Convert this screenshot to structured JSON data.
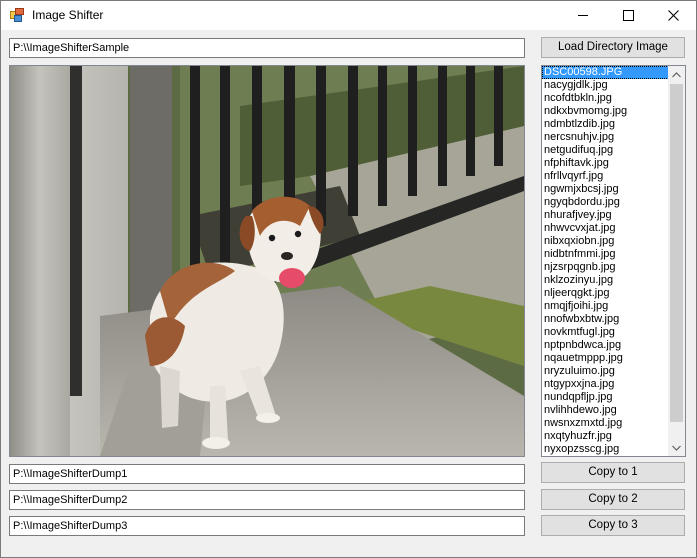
{
  "window": {
    "title": "Image Shifter",
    "controls": {
      "minimize": "minimize-icon",
      "maximize": "maximize-icon",
      "close": "close-icon"
    }
  },
  "source": {
    "path": "P:\\\\ImageShifterSample",
    "load_button": "Load Directory Image"
  },
  "files": [
    "DSC00598.JPG",
    "nacygjdlk.jpg",
    "ncofdtbkln.jpg",
    "ndkxbvmomg.jpg",
    "ndmbtlzdib.jpg",
    "nercsnuhjv.jpg",
    "netgudifuq.jpg",
    "nfphiftavk.jpg",
    "nfrllvqyrf.jpg",
    "ngwmjxbcsj.jpg",
    "ngyqbdordu.jpg",
    "nhurafjvey.jpg",
    "nhwvcvxjat.jpg",
    "nibxqxiobn.jpg",
    "nidbtnfmmi.jpg",
    "njzsrpqgnb.jpg",
    "nklzozinyu.jpg",
    "nljeerqgkt.jpg",
    "nmqjfjoihi.jpg",
    "nnofwbxbtw.jpg",
    "novkmtfugl.jpg",
    "nptpnbdwca.jpg",
    "nqauetmppp.jpg",
    "nryzuluimo.jpg",
    "ntgypxxjna.jpg",
    "nundqpfljp.jpg",
    "nvlihhdewo.jpg",
    "nwsnxzmxtd.jpg",
    "nxqtyhuzfr.jpg",
    "nyxopzssсg.jpg"
  ],
  "selected_file_index": 0,
  "destinations": [
    {
      "path": "P:\\\\ImageShifterDump1",
      "button": "Copy to 1"
    },
    {
      "path": "P:\\\\ImageShifterDump2",
      "button": "Copy to 2"
    },
    {
      "path": "P:\\\\ImageShifterDump3",
      "button": "Copy to 3"
    }
  ],
  "colors": {
    "selection": "#3399ff",
    "button_face": "#e1e1e1",
    "window_bg": "#f0f0f0"
  }
}
